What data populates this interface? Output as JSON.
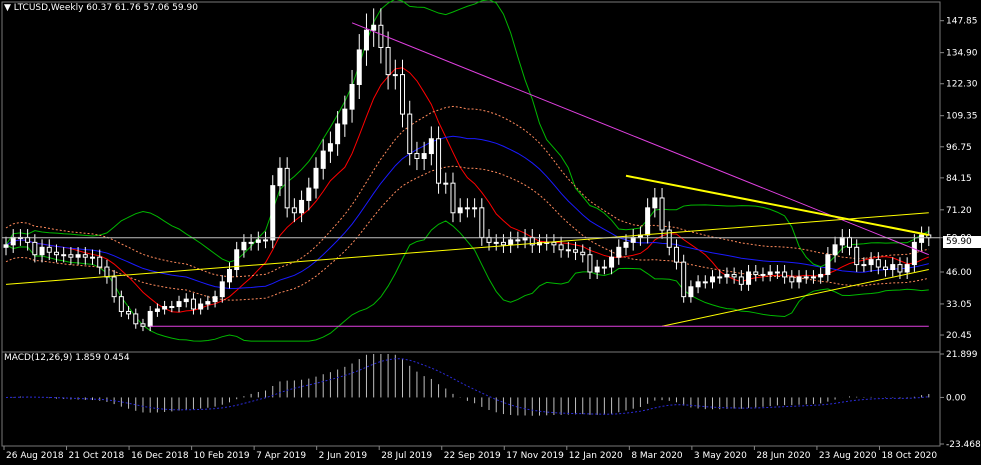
{
  "header": {
    "symbol_text": "LTCUSD,Weekly",
    "ohlc_text": "60.37 61.76 57.06 59.90"
  },
  "macd_header": "MACD(12,26,9) 1.859 0.454",
  "current_price_label": "59.90",
  "chart_data": [
    {
      "type": "candlestick",
      "title": "LTCUSD,Weekly",
      "y_ticks": [
        "147.85",
        "134.90",
        "122.30",
        "109.35",
        "96.75",
        "84.15",
        "71.20",
        "59.90",
        "46.00",
        "33.05",
        "20.45"
      ],
      "y_range": [
        16,
        153
      ],
      "x_ticks": [
        "26 Aug 2018",
        "21 Oct 2018",
        "16 Dec 2018",
        "10 Feb 2019",
        "7 Apr 2019",
        "2 Jun 2019",
        "28 Jul 2019",
        "22 Sep 2019",
        "17 Nov 2019",
        "12 Jan 2020",
        "8 Mar 2020",
        "3 May 2020",
        "28 Jun 2020",
        "23 Aug 2020",
        "18 Oct 2020"
      ],
      "close": [
        57,
        60,
        60,
        58,
        53,
        56,
        54,
        53,
        53,
        52,
        53,
        52,
        52,
        48,
        44,
        36,
        30,
        29,
        25,
        24,
        30,
        31,
        32,
        32,
        34,
        35,
        31,
        33,
        34,
        36,
        42,
        47,
        55,
        58,
        58,
        59,
        59,
        81,
        88,
        72,
        70,
        75,
        80,
        88,
        95,
        98,
        106,
        112,
        122,
        136,
        144,
        146,
        137,
        126,
        126,
        110,
        94,
        92,
        94,
        100,
        82,
        82,
        70,
        72,
        72,
        72,
        60,
        58,
        58,
        57,
        59,
        59,
        60,
        57,
        58,
        58,
        57,
        55,
        55,
        54,
        53,
        46,
        48,
        48,
        52,
        56,
        58,
        60,
        61,
        72,
        76,
        63,
        56,
        50,
        36,
        40,
        42,
        42,
        44,
        44,
        45,
        44,
        41,
        46,
        45,
        45,
        46,
        46,
        44,
        42,
        44,
        44,
        44,
        45,
        53,
        57,
        60,
        56,
        49,
        49,
        51,
        48,
        47,
        49,
        46,
        49,
        58,
        61,
        59.9
      ],
      "colors": {
        "bull": "#ffffff",
        "bear": "#ffffff",
        "background": "#000000",
        "macd_hist": "#c0c0c0",
        "signal": "#2b2bd8",
        "ma_red": "#ff0000",
        "ma_blue": "#1a1aff",
        "bands": "#00b800",
        "trend_magenta": "#e040e0",
        "trend_yellow": "#ffff00",
        "price_line": "#c0c0c0"
      }
    },
    {
      "type": "bar",
      "title": "MACD(12,26,9)",
      "y_ticks": [
        "21.899",
        "0.00",
        "-23.468"
      ],
      "y_range": [
        -23.468,
        21.899
      ],
      "macd_value": 1.859,
      "signal_value": 0.454
    }
  ]
}
